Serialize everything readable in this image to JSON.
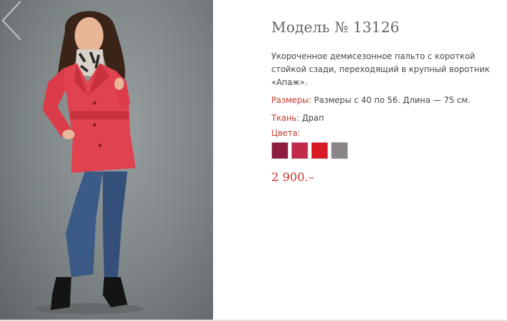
{
  "product": {
    "title": "Модель № 13126",
    "description": "Укороченное демисезонное пальто с короткой стойкой сзади, переходящий в крупный воротник «Апаж».",
    "sizes_label": "Размеры:",
    "sizes_value": "Размеры с 40 по 56. Длина — 75 см.",
    "fabric_label": "Ткань:",
    "fabric_value": "Драп",
    "colors_label": "Цвета:",
    "swatches": [
      {
        "name": "burgundy",
        "color": "#8e1c3e"
      },
      {
        "name": "raspberry",
        "color": "#c02a4a"
      },
      {
        "name": "red",
        "color": "#d81a22"
      },
      {
        "name": "grey",
        "color": "#8a8687"
      }
    ],
    "price": "2 900.–"
  },
  "gallery": {
    "prev_icon": "chevron-left-icon",
    "coat_color": "#e0424f"
  }
}
